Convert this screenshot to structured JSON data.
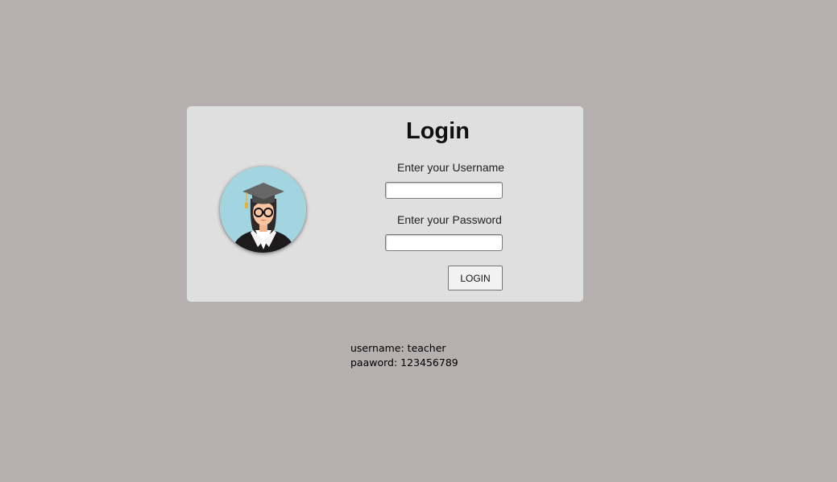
{
  "login": {
    "title": "Login",
    "username_label": "Enter your Username",
    "username_value": "",
    "password_label": "Enter your Password",
    "password_value": "",
    "button_label": "LOGIN"
  },
  "credentials": {
    "username_line": "username: teacher",
    "password_line": "paaword: 123456789"
  },
  "colors": {
    "page_background": "#b5afaf",
    "card_background": "#dfdfdf",
    "avatar_background": "#a3d5e1"
  },
  "avatar_icon": "graduate-teacher-avatar"
}
